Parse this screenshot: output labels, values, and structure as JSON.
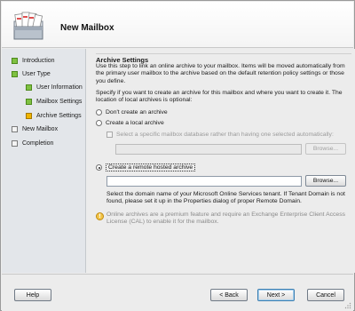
{
  "header": {
    "title": "New Mailbox",
    "icon": "mailbox-icon"
  },
  "sidebar": {
    "items": [
      {
        "label": "Introduction",
        "status": "done"
      },
      {
        "label": "User Type",
        "status": "done"
      },
      {
        "label": "User Information",
        "status": "done"
      },
      {
        "label": "Mailbox Settings",
        "status": "done"
      },
      {
        "label": "Archive Settings",
        "status": "current"
      },
      {
        "label": "New Mailbox",
        "status": "pending"
      },
      {
        "label": "Completion",
        "status": "pending"
      }
    ]
  },
  "main": {
    "section_title": "Archive Settings",
    "intro": "Use this step to link an online archive to your mailbox. Items will be moved automatically from the primary user mailbox to the archive based on the default retention policy settings or those you define.",
    "prompt": "Specify if you want to create an archive for this mailbox and where you want to create it. The location of local archives is optional:",
    "options": {
      "dont_create": "Don't create an archive",
      "create_local": "Create a local archive",
      "select_database": "Select a specific mailbox database rather than having one selected automatically:",
      "create_remote": "Create a remote hosted archive"
    },
    "local_db_value": "",
    "remote_domain_value": "",
    "browse_label": "Browse...",
    "remote_help": "Select the domain name of your Microsoft Online Services tenant. If Tenant Domain is not found, please set it up in the Properties dialog of proper Remote Domain.",
    "premium_note": "Online archives are a premium feature and require an Exchange Enterprise Client Access License (CAL) to enable it for the mailbox.",
    "selected_option": "create_remote"
  },
  "footer": {
    "help": "Help",
    "back": "< Back",
    "next": "Next >",
    "cancel": "Cancel"
  },
  "colors": {
    "done": "#7fc142",
    "current": "#f0b400",
    "pending": "#f4f4f4"
  }
}
